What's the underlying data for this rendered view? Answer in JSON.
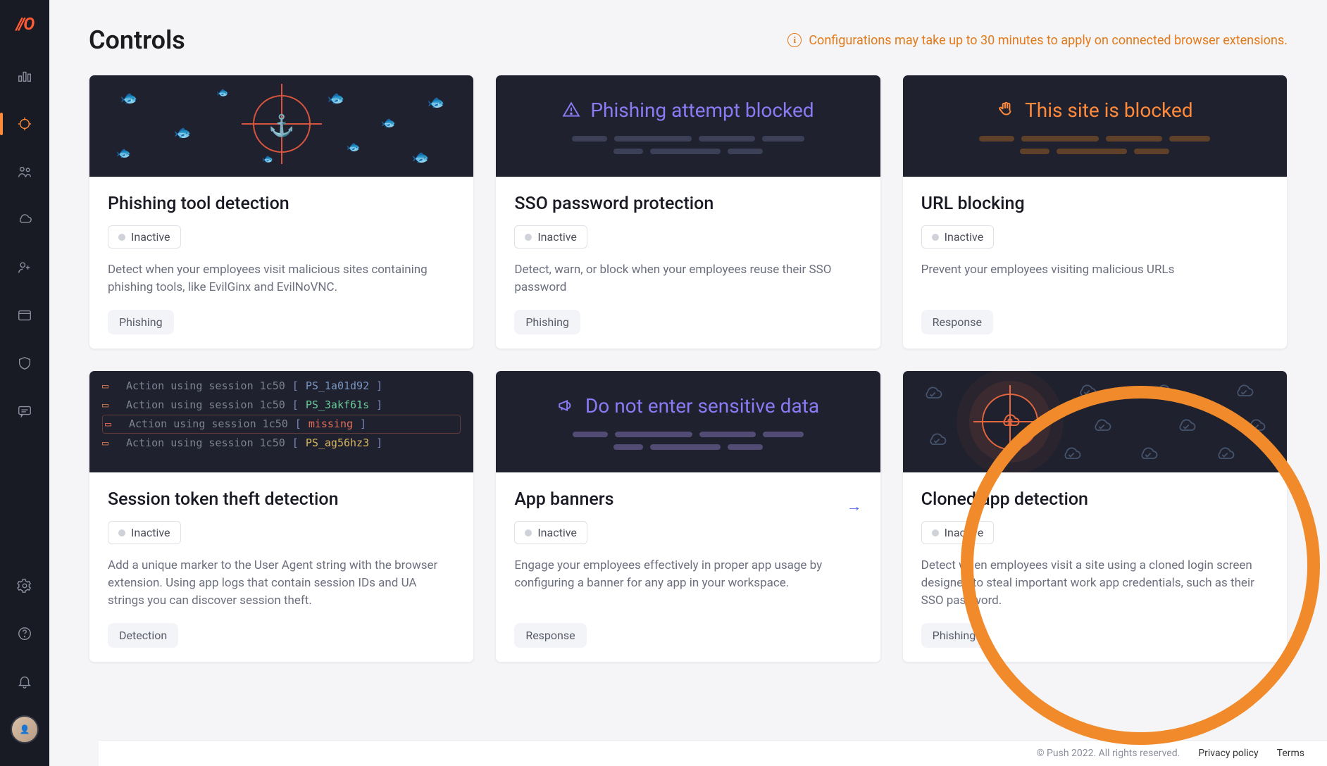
{
  "sidebar": {
    "items": [
      {
        "name": "dashboard"
      },
      {
        "name": "controls",
        "active": true
      },
      {
        "name": "people"
      },
      {
        "name": "cloud"
      },
      {
        "name": "onboarding"
      },
      {
        "name": "browser"
      },
      {
        "name": "protection"
      },
      {
        "name": "messages"
      }
    ],
    "bottom": [
      {
        "name": "settings"
      },
      {
        "name": "help"
      },
      {
        "name": "notifications"
      }
    ]
  },
  "header": {
    "title": "Controls",
    "notice": "Configurations may take up to 30 minutes to apply on connected browser extensions."
  },
  "cards": [
    {
      "title": "Phishing tool detection",
      "status": "Inactive",
      "description": "Detect when your employees visit malicious sites containing phishing tools, like EvilGinx and EvilNoVNC.",
      "tag": "Phishing",
      "hero_text": ""
    },
    {
      "title": "SSO password protection",
      "status": "Inactive",
      "description": "Detect, warn, or block when your employees reuse their SSO password",
      "tag": "Phishing",
      "hero_text": "Phishing attempt blocked"
    },
    {
      "title": "URL blocking",
      "status": "Inactive",
      "description": "Prevent your employees visiting malicious URLs",
      "tag": "Response",
      "hero_text": "This site is blocked"
    },
    {
      "title": "Session token theft detection",
      "status": "Inactive",
      "description": "Add a unique marker to the User Agent string with the browser extension. Using app logs that contain session IDs and UA strings you can discover session theft.",
      "tag": "Detection",
      "terminal": {
        "line": "Action using session 1c50",
        "tokens": [
          "PS_1a01d92",
          "PS_3akf61s",
          "missing",
          "PS_ag56hz3"
        ]
      }
    },
    {
      "title": "App banners",
      "status": "Inactive",
      "description": "Engage your employees effectively in proper app usage by configuring a banner for any app in your workspace.",
      "tag": "Response",
      "hero_text": "Do not enter sensitive data"
    },
    {
      "title": "Cloned app detection",
      "status": "Inactive",
      "description": "Detect when employees visit a site using a cloned login screen designed to steal important work app credentials, such as their SSO password.",
      "tag": "Phishing",
      "hero_text": ""
    }
  ],
  "footer": {
    "copyright": "© Push 2022. All rights reserved.",
    "links": [
      "Privacy policy",
      "Terms"
    ]
  }
}
